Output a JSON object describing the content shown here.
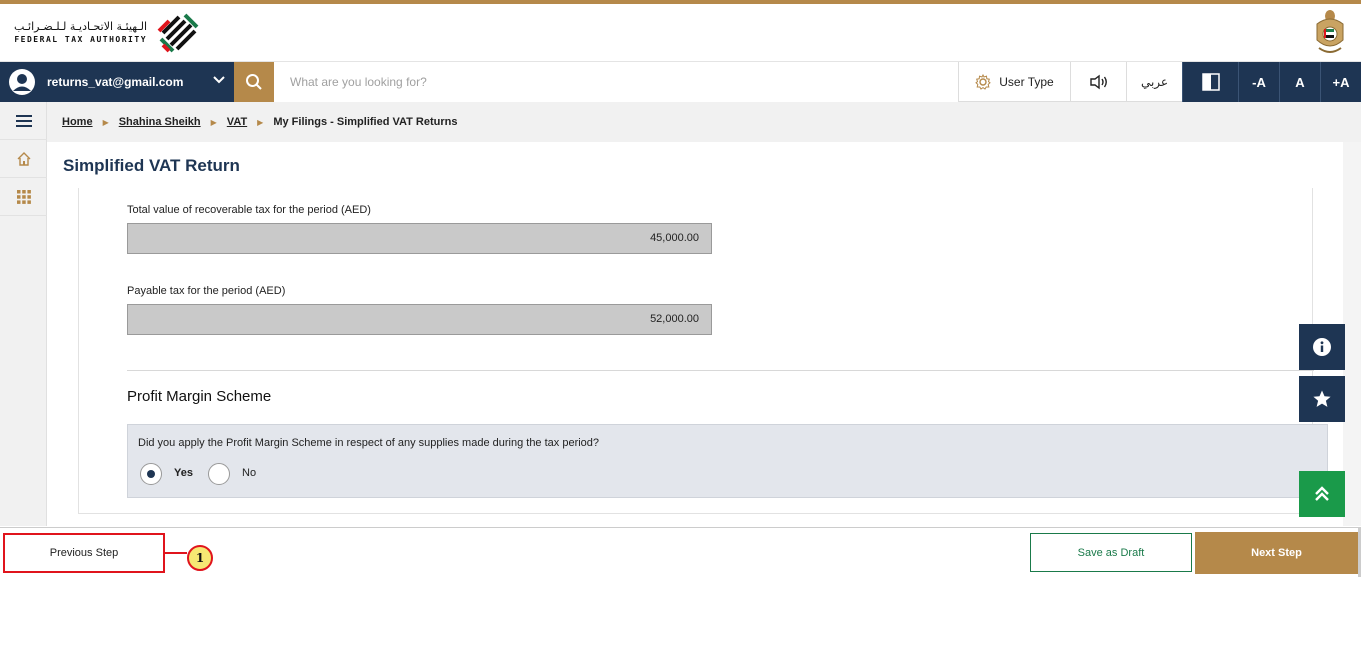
{
  "header": {
    "logo_arabic": "الـهيئـة الاتحـاديـة لـلـضـرائـب",
    "logo_english": "FEDERAL TAX AUTHORITY",
    "logo_icon": "fta-logo-icon",
    "emblem_icon": "uae-emblem-icon"
  },
  "navbar": {
    "user_email": "returns_vat@gmail.com",
    "search_placeholder": "What are you looking for?",
    "user_type_label": "User Type",
    "arabic_label": "عربي",
    "font_decrease": "-A",
    "font_normal": "A",
    "font_increase": "+A"
  },
  "breadcrumb": {
    "items": [
      "Home",
      "Shahina Sheikh",
      "VAT"
    ],
    "current": "My Filings - Simplified VAT Returns"
  },
  "page": {
    "title": "Simplified VAT Return",
    "fields": [
      {
        "label": "Total value of recoverable tax for the period (AED)",
        "value": "45,000.00"
      },
      {
        "label": "Payable tax for the period (AED)",
        "value": "52,000.00"
      }
    ],
    "section_title": "Profit Margin Scheme",
    "question": "Did you apply the Profit Margin Scheme in respect of any supplies made during the tax period?",
    "options": [
      "Yes",
      "No"
    ],
    "selected_option": "Yes"
  },
  "footer": {
    "previous_label": "Previous Step",
    "callout_number": "1",
    "save_draft_label": "Save as Draft",
    "next_label": "Next Step"
  },
  "colors": {
    "navy": "#1e3553",
    "gold": "#b5894a",
    "green": "#1a7a4a",
    "callout_red": "#e0141c",
    "callout_yellow": "#f6e873"
  }
}
